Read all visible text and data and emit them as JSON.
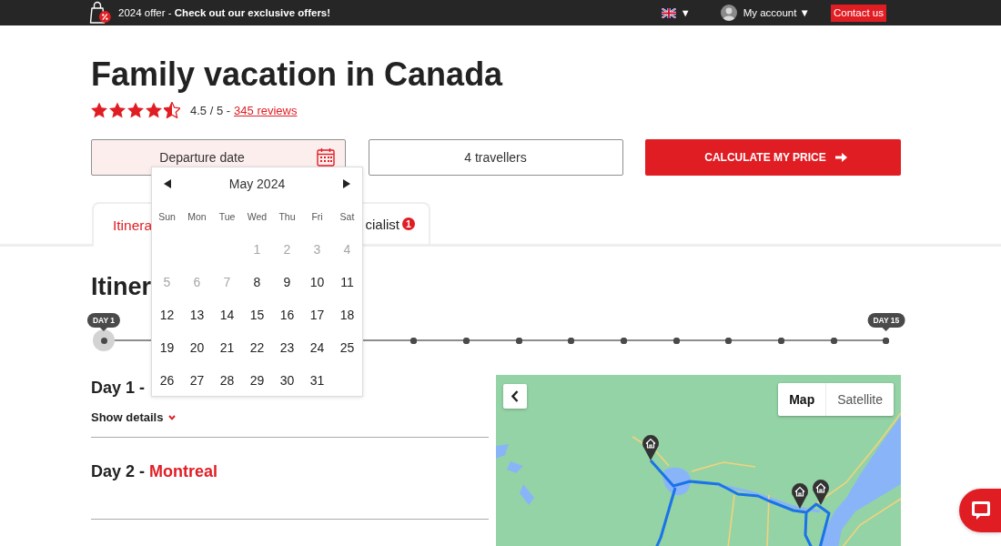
{
  "top_bar": {
    "offer": "2024 offer - **Check out our exclusive offers!**",
    "language_caret": "▼",
    "account": "My account ▼",
    "contact": "Contact us"
  },
  "title": "Family vacation in Canada",
  "rating": {
    "stars": 4.5,
    "score": "4.5 / 5 -",
    "reviews": "345 reviews"
  },
  "booking": {
    "departure": {
      "placeholder": "Departure date",
      "active": true
    },
    "travellers": {
      "value": "4 travellers"
    },
    "submit": "CALCULATE MY PRICE"
  },
  "calendar": {
    "month": "May 2024",
    "weekdays": [
      "Sun",
      "Mon",
      "Tue",
      "Wed",
      "Thu",
      "Fri",
      "Sat"
    ],
    "days": [
      {
        "kind": "blank"
      },
      {
        "kind": "blank"
      },
      {
        "kind": "blank"
      },
      {
        "kind": "day",
        "label": "1",
        "disabled": true,
        "selected": false
      },
      {
        "kind": "day",
        "label": "2",
        "disabled": true,
        "selected": false
      },
      {
        "kind": "day",
        "label": "3",
        "disabled": true,
        "selected": false
      },
      {
        "kind": "day",
        "label": "4",
        "disabled": true,
        "selected": false
      },
      {
        "kind": "day",
        "label": "5",
        "disabled": true,
        "selected": false
      },
      {
        "kind": "day",
        "label": "6",
        "disabled": true,
        "selected": false
      },
      {
        "kind": "day",
        "label": "7",
        "disabled": true,
        "selected": false
      },
      {
        "kind": "day",
        "label": "8",
        "disabled": false,
        "selected": false
      },
      {
        "kind": "day",
        "label": "9",
        "disabled": false,
        "selected": false
      },
      {
        "kind": "day",
        "label": "10",
        "disabled": false,
        "selected": false
      },
      {
        "kind": "day",
        "label": "11",
        "disabled": false,
        "selected": false
      },
      {
        "kind": "day",
        "label": "12",
        "disabled": false,
        "selected": false
      },
      {
        "kind": "day",
        "label": "13",
        "disabled": false,
        "selected": false
      },
      {
        "kind": "day",
        "label": "14",
        "disabled": false,
        "selected": false
      },
      {
        "kind": "day",
        "label": "15",
        "disabled": false,
        "selected": false
      },
      {
        "kind": "day",
        "label": "16",
        "disabled": false,
        "selected": false
      },
      {
        "kind": "day",
        "label": "17",
        "disabled": false,
        "selected": false
      },
      {
        "kind": "day",
        "label": "18",
        "disabled": false,
        "selected": false
      },
      {
        "kind": "day",
        "label": "19",
        "disabled": false,
        "selected": false
      },
      {
        "kind": "day",
        "label": "20",
        "disabled": false,
        "selected": false
      },
      {
        "kind": "day",
        "label": "21",
        "disabled": false,
        "selected": false
      },
      {
        "kind": "day",
        "label": "22",
        "disabled": false,
        "selected": false
      },
      {
        "kind": "day",
        "label": "23",
        "disabled": false,
        "selected": false
      },
      {
        "kind": "day",
        "label": "24",
        "disabled": false,
        "selected": false
      },
      {
        "kind": "day",
        "label": "25",
        "disabled": false,
        "selected": false
      },
      {
        "kind": "day",
        "label": "26",
        "disabled": false,
        "selected": false
      },
      {
        "kind": "day",
        "label": "27",
        "disabled": false,
        "selected": false
      },
      {
        "kind": "day",
        "label": "28",
        "disabled": false,
        "selected": false
      },
      {
        "kind": "day",
        "label": "29",
        "disabled": false,
        "selected": false
      },
      {
        "kind": "day",
        "label": "30",
        "disabled": false,
        "selected": false
      },
      {
        "kind": "day",
        "label": "31",
        "disabled": false,
        "selected": false
      }
    ]
  },
  "tabs": [
    {
      "label": "Itinera",
      "selected": true
    },
    {
      "label": "cialist",
      "selected": false,
      "badge": "1"
    }
  ],
  "itinerary": {
    "heading": "Itiner",
    "timeline": [
      {
        "selected": true,
        "label": "DAY 1"
      },
      {
        "selected": false
      },
      {
        "selected": false
      },
      {
        "selected": false
      },
      {
        "selected": false
      },
      {
        "selected": false
      },
      {
        "selected": false
      },
      {
        "selected": false
      },
      {
        "selected": false
      },
      {
        "selected": false
      },
      {
        "selected": false,
        "label": "DAY 15"
      }
    ],
    "days": [
      {
        "label": "Day 1 -",
        "details": "Show details"
      },
      {
        "label": "Day 2 -",
        "place": "Montreal"
      }
    ]
  },
  "map": {
    "types": [
      {
        "label": "Map",
        "selected": true
      },
      {
        "label": "Satellite",
        "selected": false
      }
    ]
  }
}
